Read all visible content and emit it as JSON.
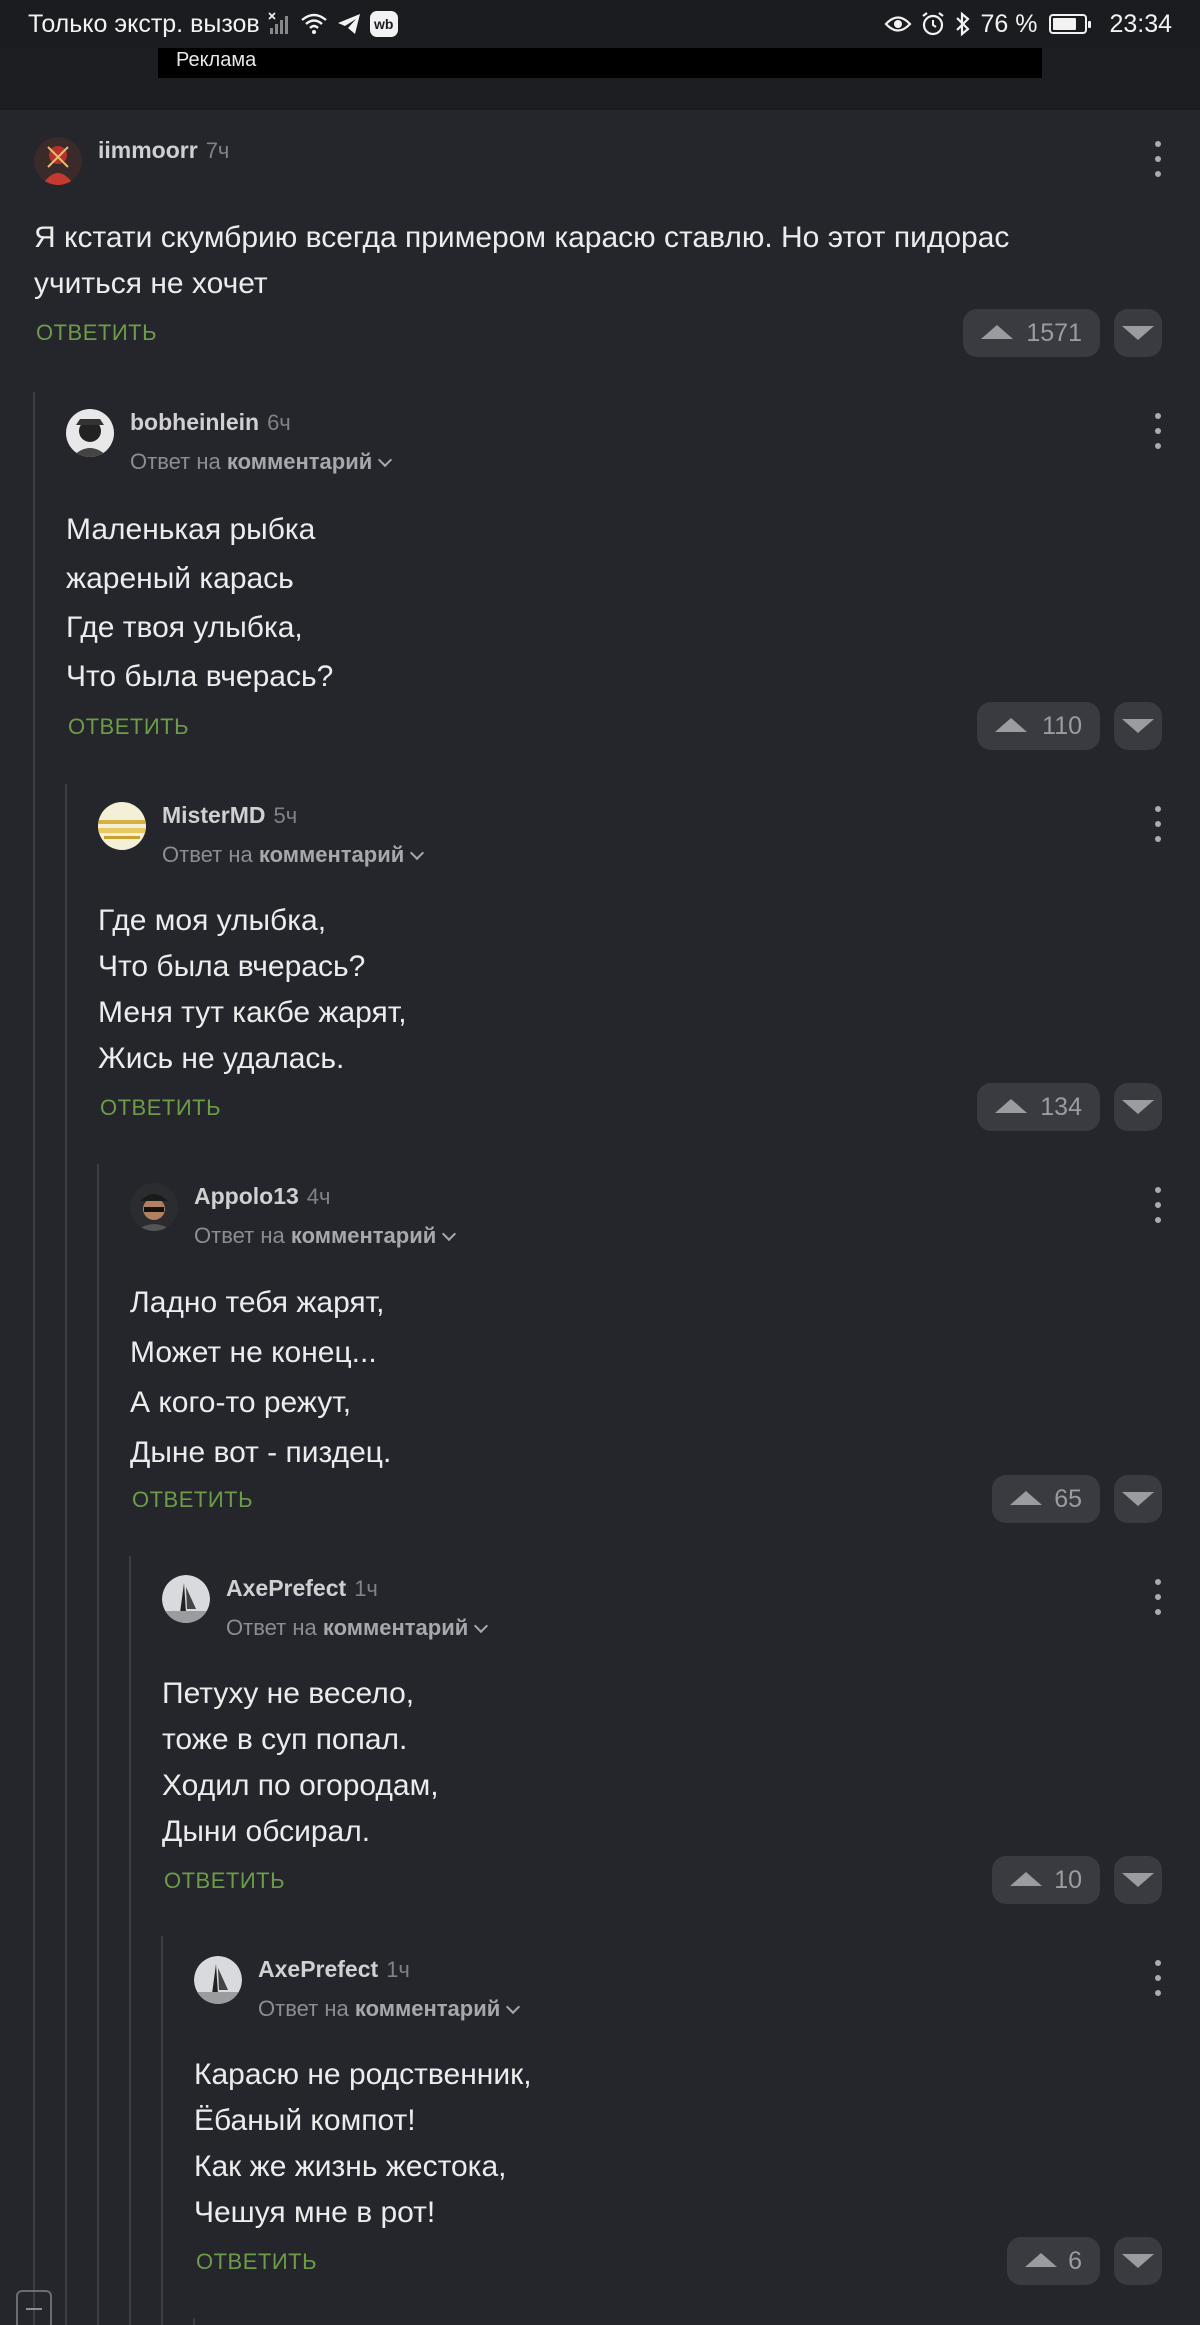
{
  "status_bar": {
    "left_text": "Только экстр. вызов",
    "battery": "76 %",
    "battery_level": 0.76,
    "time": "23:34",
    "icons": [
      "signal-icon",
      "wifi-icon",
      "telegram-icon",
      "wb-icon",
      "eye-icon",
      "alarm-icon",
      "bluetooth-icon",
      "battery-icon"
    ],
    "wb_label": "wb"
  },
  "ad": {
    "label": "Реклама"
  },
  "reply_label": "ОТВЕТИТЬ",
  "reply_to_prefix": "Ответ на",
  "reply_to_target": "комментарий",
  "comments": [
    {
      "user": "iimmoorr",
      "time": "7ч",
      "lines": [
        "Я кстати скумбрию всегда примером карасю ставлю. Но этот пидорас",
        "учиться не хочет"
      ],
      "rating": "1571"
    },
    {
      "user": "bobheinlein",
      "time": "6ч",
      "lines": [
        "Маленькая рыбка",
        "жареный карась",
        "Где твоя улыбка,",
        "Что была вчерась?"
      ],
      "rating": "110"
    },
    {
      "user": "MisterMD",
      "time": "5ч",
      "lines": [
        "Где моя улыбка,",
        "Что была вчерась?",
        "Меня тут какбе жарят,",
        "Жись не удалась."
      ],
      "rating": "134"
    },
    {
      "user": "Appolo13",
      "time": "4ч",
      "lines": [
        "Ладно тебя жарят,",
        "Может не конец...",
        "А кого-то режут,",
        "Дыне вот - пиздец."
      ],
      "rating": "65"
    },
    {
      "user": "AxePrefect",
      "time": "1ч",
      "lines": [
        "Петуху не весело,",
        "тоже в суп попал.",
        "Ходил по огородам,",
        "Дыни обсирал."
      ],
      "rating": "10"
    },
    {
      "user": "AxePrefect",
      "time": "1ч",
      "lines": [
        "Карасю не родственник,",
        "Ёбаный компот!",
        "Как же жизнь жестока,",
        "Чешуя мне в рот!"
      ],
      "rating": "6"
    }
  ]
}
